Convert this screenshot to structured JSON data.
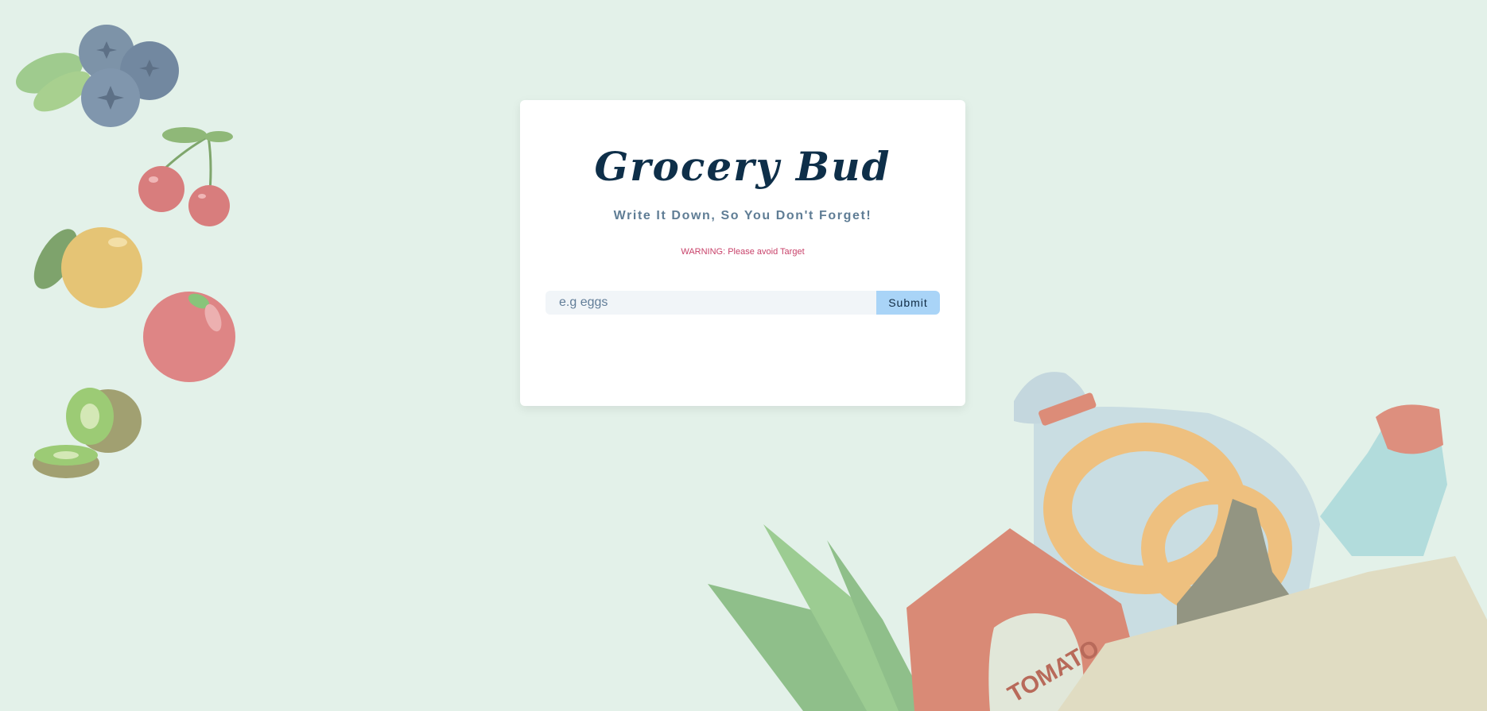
{
  "app": {
    "title": "Grocery Bud",
    "subtitle": "Write It Down, So You Don't Forget!",
    "warning": "WARNING: Please avoid Target"
  },
  "form": {
    "input_value": "",
    "input_placeholder": "e.g eggs",
    "submit_label": "Submit"
  },
  "background": {
    "color": "#e3f1e9",
    "illustration_text": "TOMATO"
  }
}
